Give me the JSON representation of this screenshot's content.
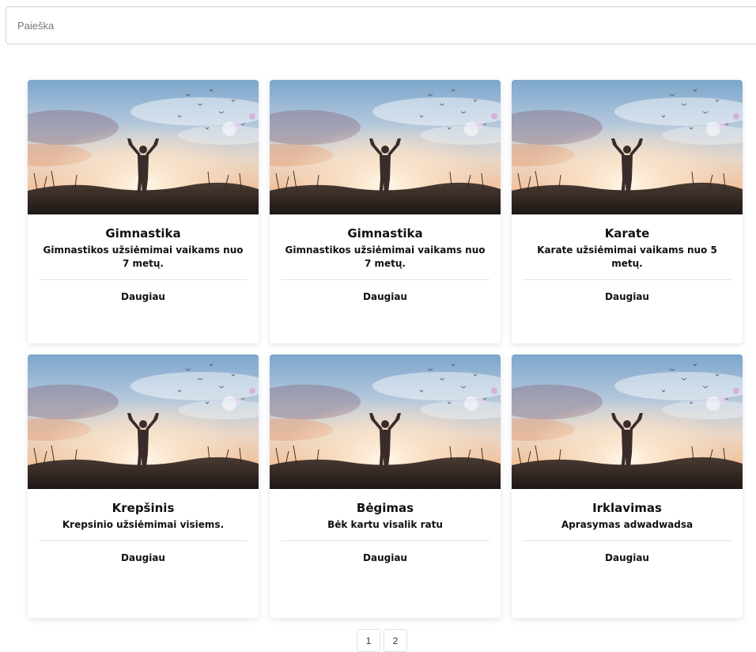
{
  "search": {
    "placeholder": "Paieška",
    "value": ""
  },
  "cards": [
    {
      "title": "Gimnastika",
      "text": "Gimnastikos užsiėmimai vaikams nuo 7 metų.",
      "link": "Daugiau"
    },
    {
      "title": "Gimnastika",
      "text": "Gimnastikos užsiėmimai vaikams nuo 7 metų.",
      "link": "Daugiau"
    },
    {
      "title": "Karate",
      "text": "Karate užsiėmimai vaikams nuo 5 metų.",
      "link": "Daugiau"
    },
    {
      "title": "Krepšinis",
      "text": "Krepsinio užsiėmimai visiems.",
      "link": "Daugiau"
    },
    {
      "title": "Bėgimas",
      "text": "Bėk kartu visalik ratu",
      "link": "Daugiau"
    },
    {
      "title": "Irklavimas",
      "text": "Aprasymas adwadwadsa",
      "link": "Daugiau"
    }
  ],
  "pagination": {
    "pages": [
      "1",
      "2"
    ]
  }
}
